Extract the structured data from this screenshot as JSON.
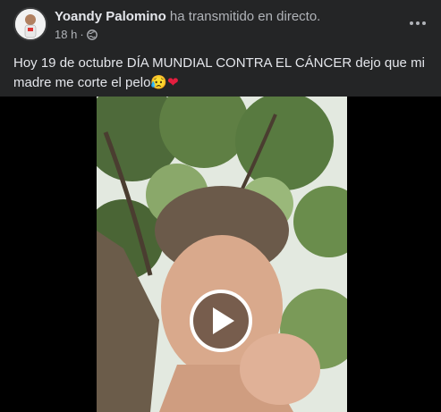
{
  "post": {
    "author": "Yoandy Palomino",
    "action": "ha transmitido en directo.",
    "time": "18 h",
    "separator": "·",
    "text": "Hoy 19 de octubre DÍA MUNDIAL CONTRA EL CÁNCER dejo que mi madre me corte el pelo",
    "emojis": {
      "sad": "😥",
      "heart": "❤"
    }
  },
  "icons": {
    "privacy": "globe-icon",
    "menu": "more-options-icon",
    "video": "play-icon"
  },
  "colors": {
    "background": "#242526",
    "primary_text": "#e4e6eb",
    "secondary_text": "#b0b3b8",
    "heart": "#e41e3f"
  }
}
